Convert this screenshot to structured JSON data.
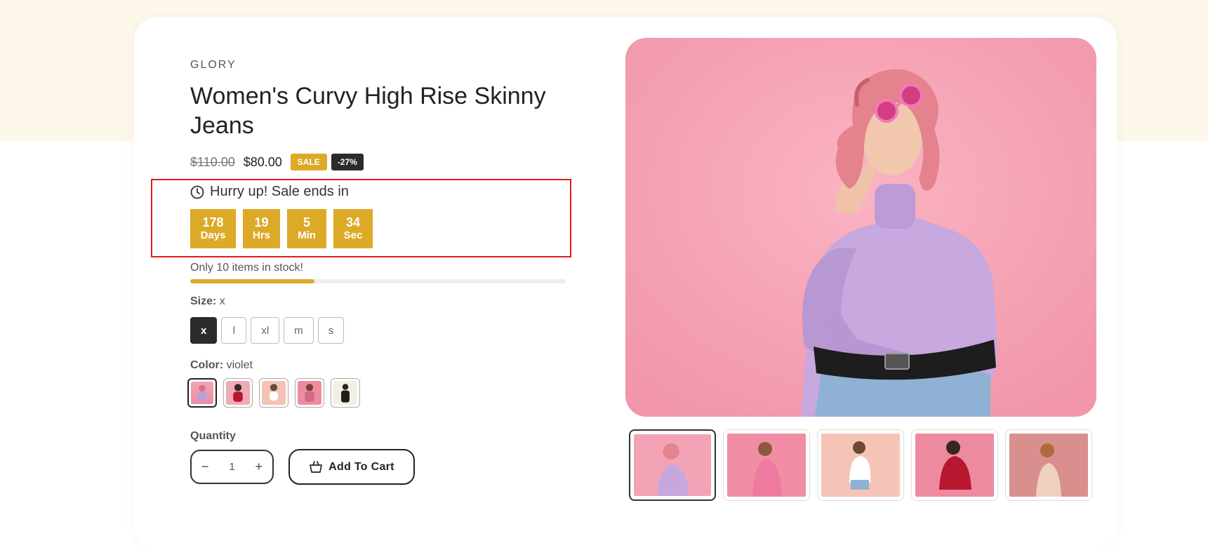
{
  "product": {
    "vendor": "GLORY",
    "title": "Women's Curvy High Rise Skinny Jeans",
    "price_old": "$110.00",
    "price_new": "$80.00",
    "badge_sale": "SALE",
    "badge_discount": "-27%"
  },
  "countdown": {
    "heading": "Hurry up! Sale ends in",
    "units": [
      {
        "value": "178",
        "label": "Days"
      },
      {
        "value": "19",
        "label": "Hrs"
      },
      {
        "value": "5",
        "label": "Min"
      },
      {
        "value": "34",
        "label": "Sec"
      }
    ]
  },
  "stock": {
    "text": "Only 10 items in stock!",
    "level_fraction": 0.33
  },
  "size": {
    "label": "Size:",
    "selected": "x",
    "options": [
      "x",
      "l",
      "xl",
      "m",
      "s"
    ]
  },
  "color": {
    "label": "Color:",
    "selected": "violet",
    "swatch_count": 5
  },
  "quantity": {
    "label": "Quantity",
    "value": "1",
    "minus": "−",
    "plus": "+"
  },
  "cart": {
    "button_label": "Add To Cart"
  },
  "colors": {
    "accent": "#dcaa27",
    "dark": "#2b2b2b",
    "band": "#fdf8ea",
    "highlight_border": "#e01b1b"
  }
}
